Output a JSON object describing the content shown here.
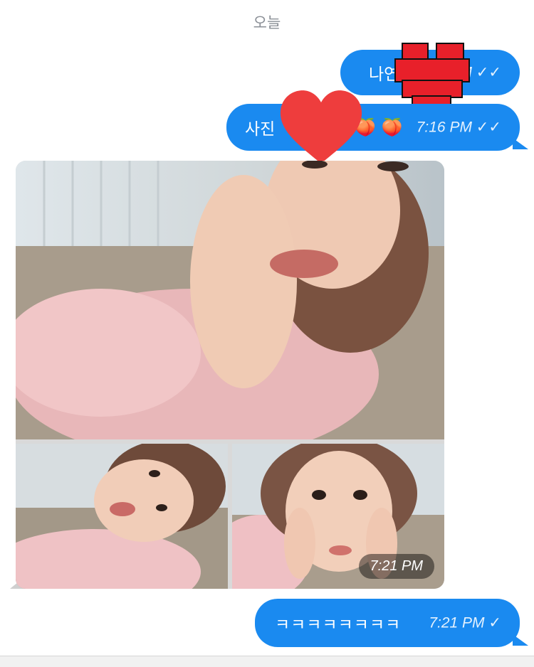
{
  "date_header": "오늘",
  "messages": [
    {
      "text": "나연",
      "time": "M",
      "status": "✓✓",
      "censor": "pixel-heart"
    },
    {
      "text": "사진",
      "emoji": "🍑 🍑",
      "time": "7:16 PM",
      "status": "✓✓",
      "censor": "heart"
    },
    {
      "type": "image-group",
      "images": [
        "selfie-hand-on-cheek",
        "selfie-lying-down",
        "selfie-hands-on-face"
      ],
      "time": "7:21 PM"
    },
    {
      "text": "ㅋㅋㅋㅋㅋㅋㅋㅋ",
      "time": "7:21 PM",
      "status": "✓"
    }
  ],
  "colors": {
    "bubble": "#1a8af0",
    "censor_red": "#e8202a",
    "heart_red": "#ee3d3d"
  }
}
